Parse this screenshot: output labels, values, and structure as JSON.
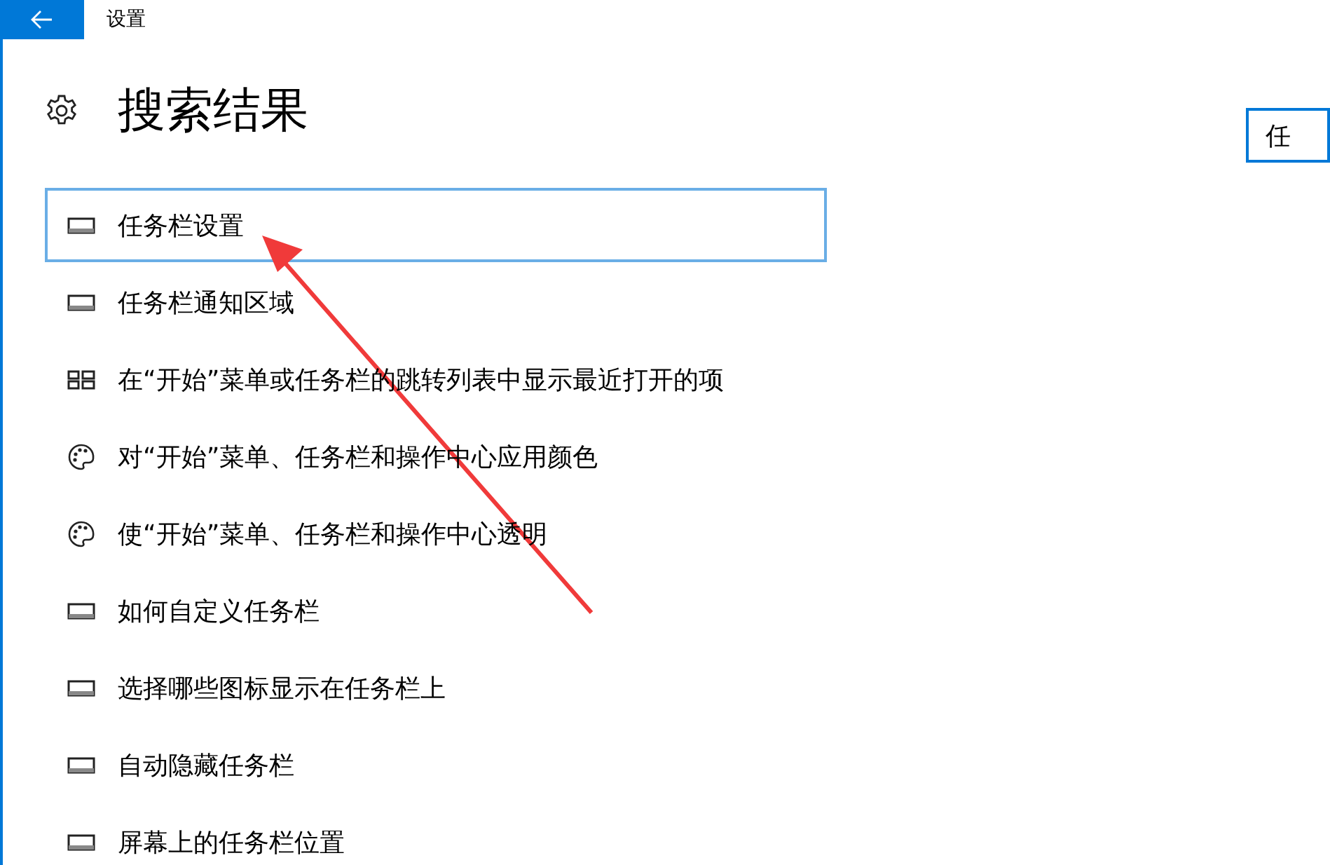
{
  "window": {
    "title": "设置"
  },
  "heading": "搜索结果",
  "search": {
    "value": "任"
  },
  "results": [
    {
      "label": "任务栏设置",
      "kind": "taskbar",
      "selected": true
    },
    {
      "label": "任务栏通知区域",
      "kind": "taskbar",
      "selected": false
    },
    {
      "label": "在“开始”菜单或任务栏的跳转列表中显示最近打开的项",
      "kind": "tiles",
      "selected": false
    },
    {
      "label": "对“开始”菜单、任务栏和操作中心应用颜色",
      "kind": "palette",
      "selected": false
    },
    {
      "label": "使“开始”菜单、任务栏和操作中心透明",
      "kind": "palette",
      "selected": false
    },
    {
      "label": "如何自定义任务栏",
      "kind": "taskbar",
      "selected": false
    },
    {
      "label": "选择哪些图标显示在任务栏上",
      "kind": "taskbar",
      "selected": false
    },
    {
      "label": "自动隐藏任务栏",
      "kind": "taskbar",
      "selected": false
    },
    {
      "label": "屏幕上的任务栏位置",
      "kind": "taskbar",
      "selected": false
    }
  ]
}
